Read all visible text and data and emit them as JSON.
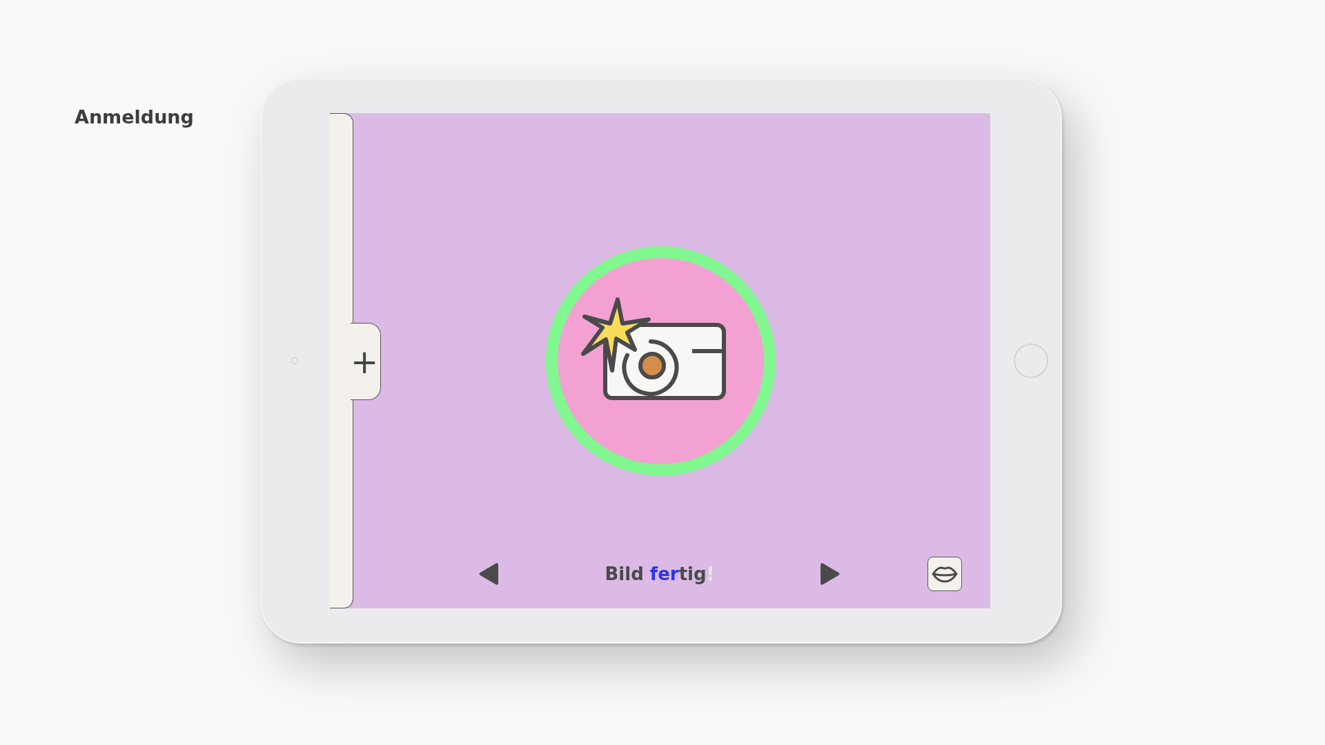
{
  "page_title": "Anmeldung",
  "drawer": {
    "add_symbol": "+"
  },
  "caption": {
    "parts": [
      {
        "text": "Bild ",
        "kind": "read"
      },
      {
        "text": "fer",
        "kind": "current"
      },
      {
        "text": "tig",
        "kind": "read"
      },
      {
        "text": "!",
        "kind": "pending"
      }
    ]
  }
}
